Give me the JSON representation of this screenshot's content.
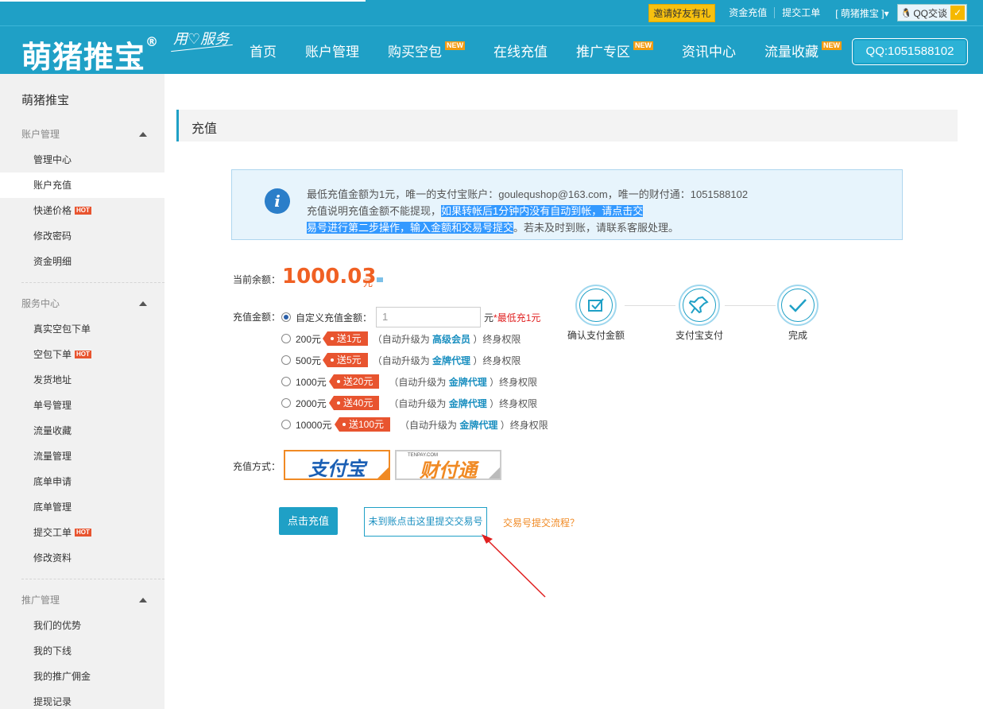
{
  "topbar": {
    "invite": "邀请好友有礼",
    "links": [
      "资金充值",
      "提交工单"
    ],
    "user": "[ 萌猪推宝 ]",
    "qq_chat": "QQ交谈"
  },
  "header": {
    "logo": "萌猪推宝",
    "logo_mark": "®",
    "slogan": "用♡服务",
    "nav": [
      {
        "label": "首页",
        "new": ""
      },
      {
        "label": "账户管理",
        "new": ""
      },
      {
        "label": "购买空包",
        "new": "NEW"
      },
      {
        "label": "在线充值",
        "new": ""
      },
      {
        "label": "推广专区",
        "new": "NEW"
      },
      {
        "label": "资讯中心",
        "new": ""
      },
      {
        "label": "流量收藏",
        "new": "NEW"
      }
    ],
    "qq_number": "QQ:1051588102"
  },
  "sidebar": {
    "title": "萌猪推宝",
    "groups": [
      {
        "title": "账户管理",
        "items": [
          {
            "label": "管理中心",
            "hot": ""
          },
          {
            "label": "账户充值",
            "hot": ""
          },
          {
            "label": "快递价格",
            "hot": "HOT"
          },
          {
            "label": "修改密码",
            "hot": ""
          },
          {
            "label": "资金明细",
            "hot": ""
          }
        ]
      },
      {
        "title": "服务中心",
        "items": [
          {
            "label": "真实空包下单",
            "hot": ""
          },
          {
            "label": "空包下单",
            "hot": "HOT"
          },
          {
            "label": "发货地址",
            "hot": ""
          },
          {
            "label": "单号管理",
            "hot": ""
          },
          {
            "label": "流量收藏",
            "hot": ""
          },
          {
            "label": "流量管理",
            "hot": ""
          },
          {
            "label": "底单申请",
            "hot": ""
          },
          {
            "label": "底单管理",
            "hot": ""
          },
          {
            "label": "提交工单",
            "hot": "HOT"
          },
          {
            "label": "修改资料",
            "hot": ""
          }
        ]
      },
      {
        "title": "推广管理",
        "items": [
          {
            "label": "我们的优势",
            "hot": ""
          },
          {
            "label": "我的下线",
            "hot": ""
          },
          {
            "label": "我的推广佣金",
            "hot": ""
          },
          {
            "label": "提现记录",
            "hot": ""
          }
        ]
      }
    ]
  },
  "main": {
    "page_title": "充值",
    "notice": {
      "part1": "最低充值金额为1元，唯一的支付宝账户：goulequshop@163.com，唯一的财付通：1051588102  充值说明充值金额不能提现，",
      "highlight1": "如果转帐后1分钟内没有自动到帐，请点击交",
      "highlight2": "易号进行第二步操作，输入金额和交易号提交",
      "part2": "。若未及时到账，请联系客服处理。"
    },
    "balance_label": "当前余额：",
    "balance_value": "1000.03",
    "balance_unit": "元",
    "amount_label": "充值金额：",
    "custom_option": "自定义充值金额：",
    "custom_input_value": "1",
    "custom_unit": "元",
    "custom_min_note": "*最低充1元",
    "options": [
      {
        "amount": "200元",
        "bonus": "送1元",
        "upgrade_prefix": "（自动升级为",
        "level": "高级会员",
        "upgrade_suffix": "）终身权限"
      },
      {
        "amount": "500元",
        "bonus": "送5元",
        "upgrade_prefix": "（自动升级为",
        "level": "金牌代理",
        "upgrade_suffix": "）终身权限"
      },
      {
        "amount": "1000元",
        "bonus": "送20元",
        "upgrade_prefix": "（自动升级为",
        "level": "金牌代理",
        "upgrade_suffix": "）终身权限"
      },
      {
        "amount": "2000元",
        "bonus": "送40元",
        "upgrade_prefix": "（自动升级为",
        "level": "金牌代理",
        "upgrade_suffix": "）终身权限"
      },
      {
        "amount": "10000元",
        "bonus": "送100元",
        "upgrade_prefix": "（自动升级为",
        "level": "金牌代理",
        "upgrade_suffix": "）终身权限"
      }
    ],
    "steps": [
      "确认支付金额",
      "支付宝支付",
      "完成"
    ],
    "method_label": "充值方式：",
    "methods": [
      {
        "name": "支付宝",
        "selected": true
      },
      {
        "name": "财付通",
        "selected": false,
        "sub": "TENPAY.COM"
      }
    ],
    "recharge_button": "点击充值",
    "submit_txn_button": "未到账点击这里提交交易号",
    "txn_flow_link": "交易号提交流程？"
  },
  "colors": {
    "brand": "#1fa0c6",
    "accent_orange": "#f06023",
    "hot_red": "#e8542f",
    "annotation_arrow": "#e02020"
  }
}
